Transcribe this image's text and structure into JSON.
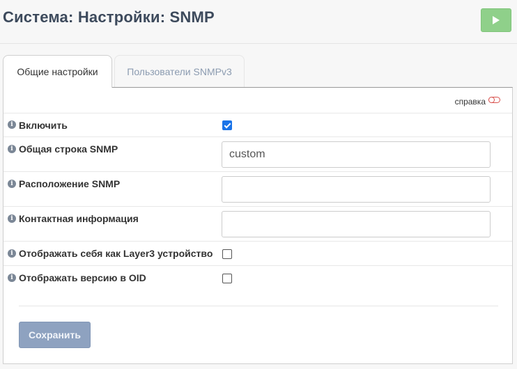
{
  "header": {
    "title": "Система: Настройки: SNMP",
    "run_icon": "play-icon"
  },
  "tabs": [
    {
      "label": "Общие настройки",
      "active": true
    },
    {
      "label": "Пользователи SNMPv3",
      "active": false
    }
  ],
  "help": {
    "label": "справка",
    "enabled": false
  },
  "form": {
    "enable": {
      "label": "Включить",
      "checked": true
    },
    "community": {
      "label": "Общая строка SNMP",
      "value": "custom"
    },
    "location": {
      "label": "Расположение SNMP",
      "value": ""
    },
    "contact": {
      "label": "Контактная информация",
      "value": ""
    },
    "layer3": {
      "label": "Отображать себя как Layer3 устройство",
      "checked": false
    },
    "oid_version": {
      "label": "Отображать версию в OID",
      "checked": false
    }
  },
  "actions": {
    "save_label": "Сохранить"
  },
  "colors": {
    "run_button": "#8fd08a",
    "save_button": "#8ea2c0",
    "checkbox_checked": "#1a73e8",
    "help_toggle": "#d9534f"
  }
}
